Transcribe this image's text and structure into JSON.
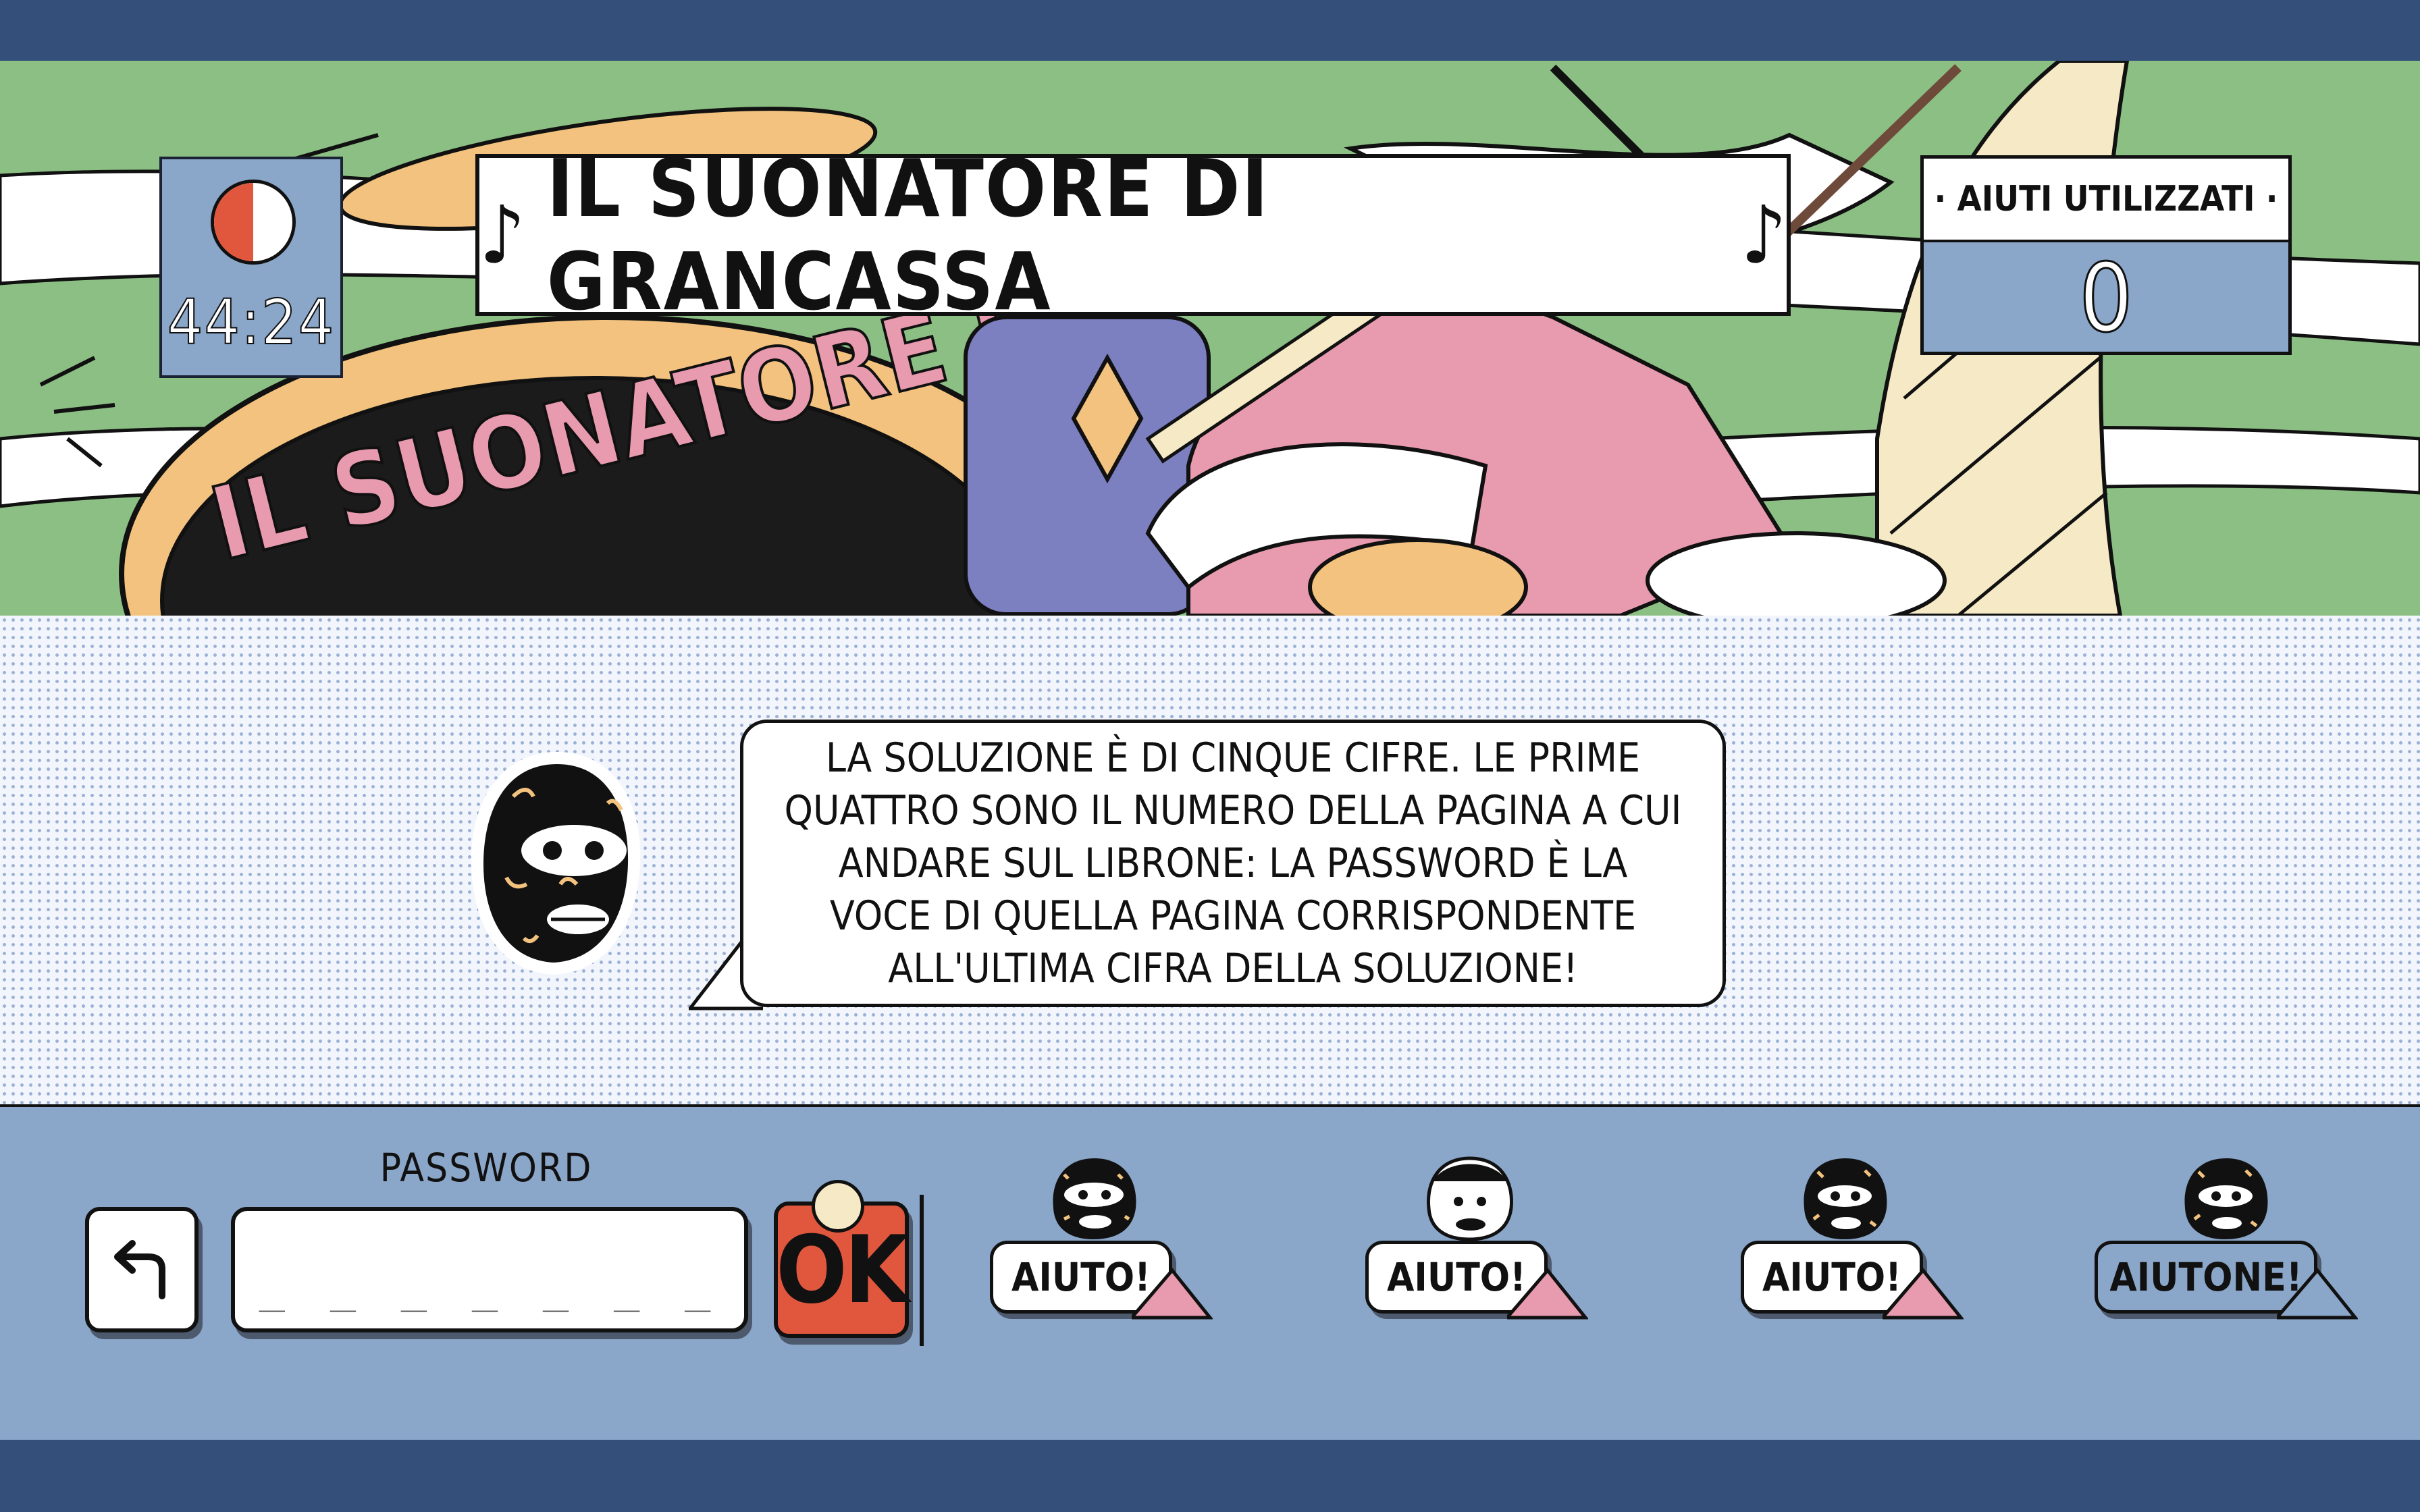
{
  "header": {
    "timer": "44:24",
    "note_left": "♪",
    "title": "IL SUONATORE DI GRANCASSA",
    "note_right": "♪",
    "helps_label": "· AIUTI UTILIZZATI ·",
    "helps_count": "0",
    "drum_lettering": "IL SUONATORE DI"
  },
  "dialog": {
    "text": "La soluzione è di cinque cifre. Le prime quattro sono il numero della pagina a cui andare sul librone: la password è la voce di quella pagina corrispondente all'ultima cifra della soluzione!"
  },
  "controls": {
    "password_label": "PASSWORD",
    "password_placeholder": "_ _ _ _ _ _ _",
    "ok_label": "OK",
    "back_icon": "undo-arrow-icon",
    "helps": [
      {
        "label": "AIUTO!"
      },
      {
        "label": "AIUTO!"
      },
      {
        "label": "AIUTO!"
      },
      {
        "label": "AIUTONE!"
      }
    ]
  },
  "colors": {
    "navy": "#344f7a",
    "panel_blue": "#8aa6c9",
    "banner_green": "#8cbf84",
    "accent_red": "#e0573e",
    "pink": "#e89aae"
  }
}
